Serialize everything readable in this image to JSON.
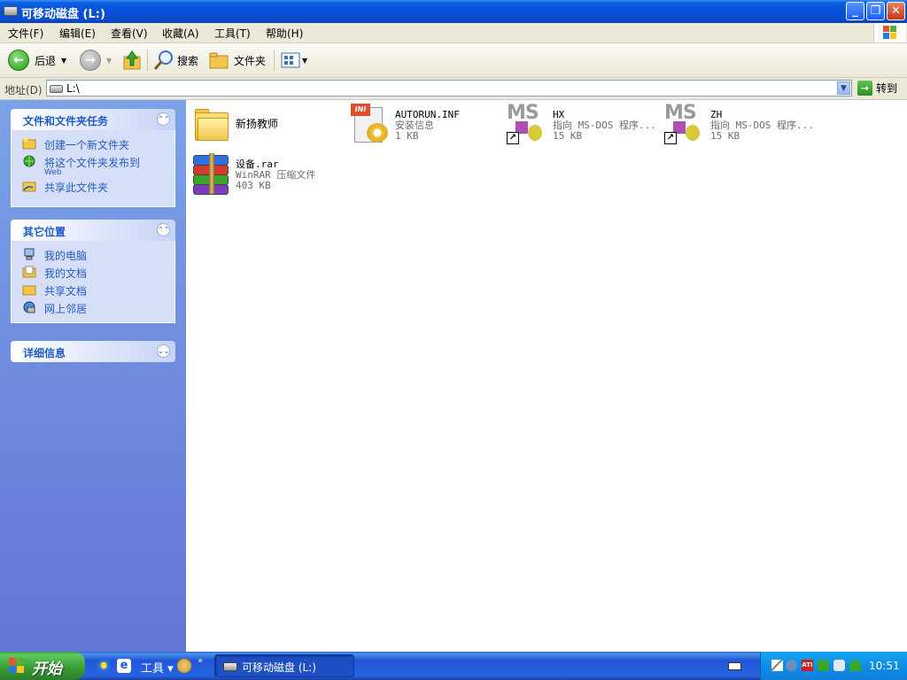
{
  "window": {
    "title": "可移动磁盘 (L:)",
    "buttons": {
      "minimize": "_",
      "maximize": "❐",
      "close": "✕"
    }
  },
  "menu": {
    "items": [
      "文件(F)",
      "编辑(E)",
      "查看(V)",
      "收藏(A)",
      "工具(T)",
      "帮助(H)"
    ]
  },
  "toolbar": {
    "back_label": "后退",
    "search_label": "搜索",
    "folders_label": "文件夹"
  },
  "address": {
    "label": "地址(D)",
    "value": "L:\\",
    "go_label": "转到"
  },
  "task_pane": {
    "file_tasks": {
      "title": "文件和文件夹任务",
      "items": [
        {
          "label": "创建一个新文件夹",
          "icon": "new-folder-icon"
        },
        {
          "label": "将这个文件夹发布到",
          "sub": "Web",
          "icon": "publish-web-icon"
        },
        {
          "label": "共享此文件夹",
          "icon": "share-folder-icon"
        }
      ]
    },
    "other_places": {
      "title": "其它位置",
      "items": [
        {
          "label": "我的电脑",
          "icon": "my-computer-icon"
        },
        {
          "label": "我的文档",
          "icon": "my-documents-icon"
        },
        {
          "label": "共享文档",
          "icon": "shared-documents-icon"
        },
        {
          "label": "网上邻居",
          "icon": "network-places-icon"
        }
      ]
    },
    "details": {
      "title": "详细信息"
    }
  },
  "files": [
    {
      "name": "新扬教师",
      "type": "folder",
      "icon": "folder-icon"
    },
    {
      "name": "AUTORUN.INF",
      "desc": "安装信息",
      "size": "1 KB",
      "icon": "ini-file-icon"
    },
    {
      "name": "HX",
      "desc": "指向 MS-DOS 程序...",
      "size": "15 KB",
      "icon": "msdos-shortcut-icon"
    },
    {
      "name": "ZH",
      "desc": "指向 MS-DOS 程序...",
      "size": "15 KB",
      "icon": "msdos-shortcut-icon"
    },
    {
      "name": "设备.rar",
      "desc": "WinRAR 压缩文件",
      "size": "403 KB",
      "icon": "winrar-icon"
    }
  ],
  "taskbar": {
    "start_label": "开始",
    "quick_launch_tools": "工具",
    "task_button_label": "可移动磁盘 (L:)",
    "clock": "10:51"
  },
  "colors": {
    "title_blue": "#0a5fe1",
    "taskpane_link": "#215dc6",
    "start_green": "#379a37",
    "tray_blue": "#0f8ce8"
  }
}
